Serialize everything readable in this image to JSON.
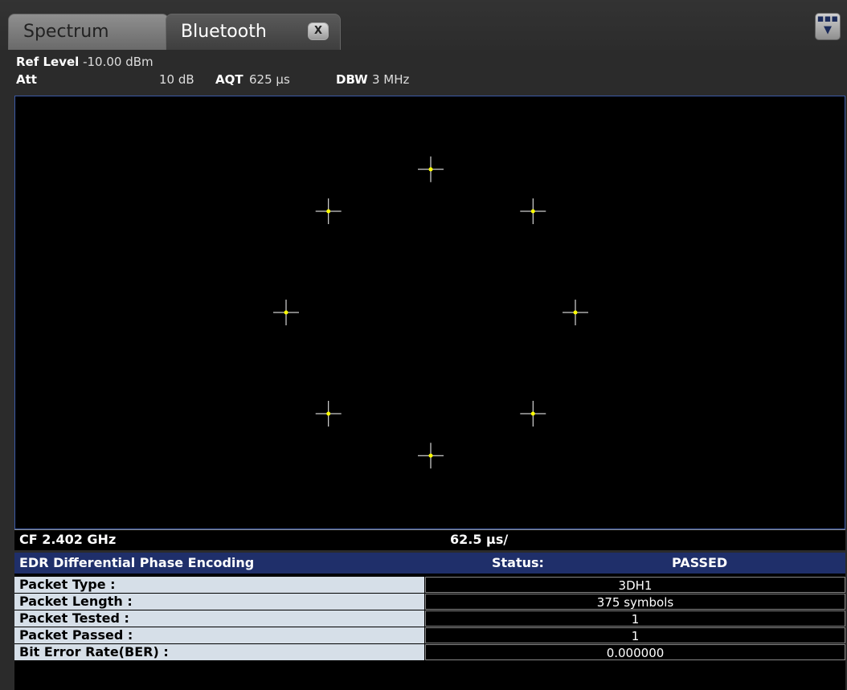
{
  "tabs": [
    {
      "label": "Spectrum"
    },
    {
      "label": "Bluetooth",
      "close_label": "X"
    }
  ],
  "menu_icon": "menu-dropdown-icon",
  "settings": {
    "ref_level_label": "Ref Level",
    "ref_level_value": "-10.00 dBm",
    "att_label": "Att",
    "att_value": "10 dB",
    "aqt_label": "AQT",
    "aqt_value": "625 µs",
    "dbw_label": "DBW",
    "dbw_value": "3 MHz"
  },
  "footer": {
    "cf": "CF 2.402 GHz",
    "div": "62.5 µs/"
  },
  "colors": {
    "marker": "#ffff00",
    "crosshair": "#ffffff",
    "plot_border": "#3c5aa8",
    "table_header": "#1f2f6a"
  },
  "table": {
    "title": "EDR Differential Phase Encoding",
    "status_label": "Status:",
    "status_value": "PASSED",
    "rows": [
      {
        "label": "Packet Type :",
        "value": "3DH1"
      },
      {
        "label": "Packet Length :",
        "value": "375 symbols"
      },
      {
        "label": "Packet Tested :",
        "value": "1"
      },
      {
        "label": "Packet Passed :",
        "value": "1"
      },
      {
        "label": "Bit Error Rate(BER) :",
        "value": "0.000000"
      }
    ]
  }
}
